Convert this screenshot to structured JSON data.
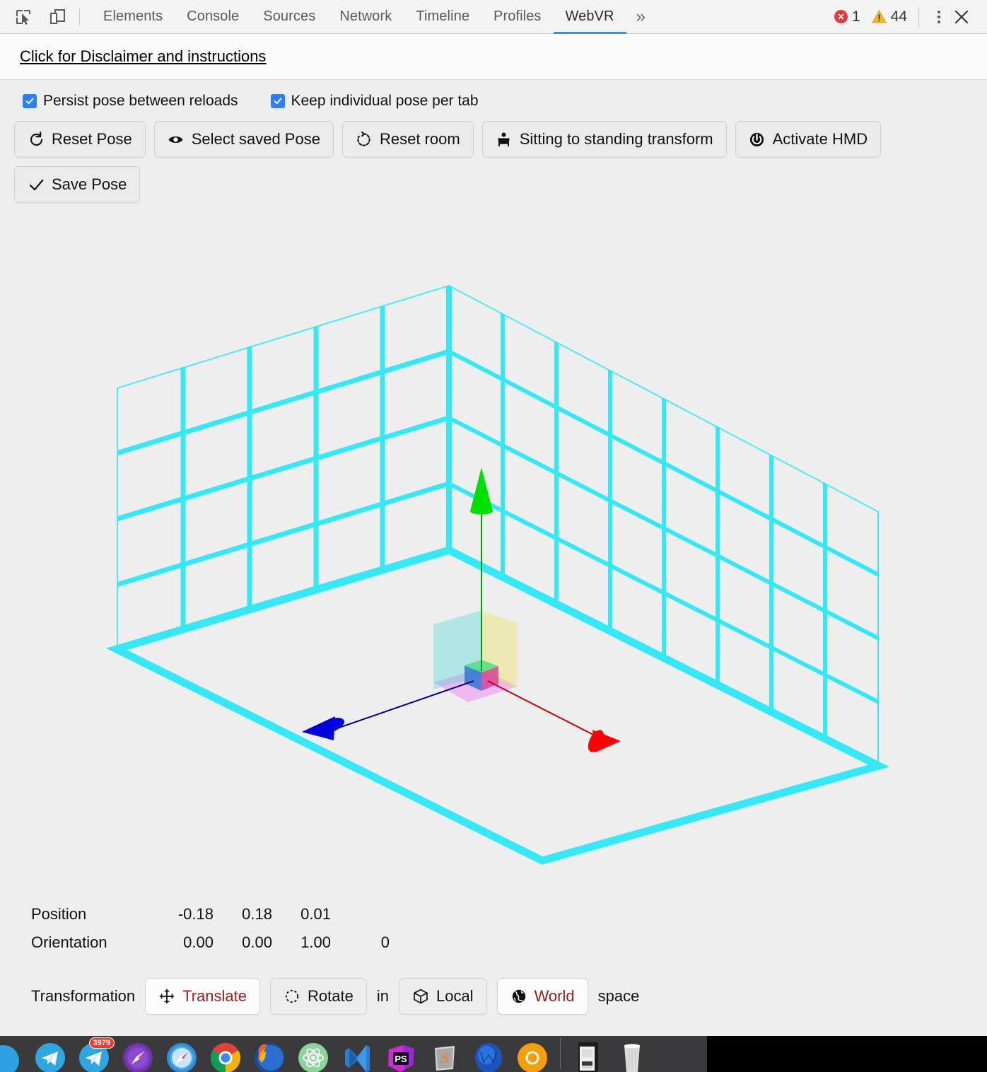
{
  "devtools": {
    "icons": [
      {
        "name": "inspect-element-icon"
      },
      {
        "name": "device-toolbar-icon"
      }
    ],
    "tabs": [
      {
        "label": "Elements",
        "active": false
      },
      {
        "label": "Console",
        "active": false
      },
      {
        "label": "Sources",
        "active": false
      },
      {
        "label": "Network",
        "active": false
      },
      {
        "label": "Timeline",
        "active": false
      },
      {
        "label": "Profiles",
        "active": false
      },
      {
        "label": "WebVR",
        "active": true
      }
    ],
    "more_tabs_glyph": "»",
    "error_count": "1",
    "warning_count": "44",
    "error_badge_glyph": "×",
    "menu_icon": "kebab-menu-icon",
    "close_icon": "close-icon",
    "accent_color": "#4285f4",
    "error_color": "#e53935",
    "warning_color": "#f2b632"
  },
  "disclaimer": {
    "link_text": "Click for Disclaimer and instructions"
  },
  "controls": {
    "checkboxes": [
      {
        "label": "Persist pose between reloads",
        "checked": true
      },
      {
        "label": "Keep individual pose per tab",
        "checked": true
      }
    ],
    "checkbox_color": "#2b7fff",
    "buttons": [
      {
        "label": "Reset Pose",
        "icon": "refresh-icon"
      },
      {
        "label": "Select saved Pose",
        "icon": "eye-icon"
      },
      {
        "label": "Reset room",
        "icon": "rotate-dashed-icon"
      },
      {
        "label": "Sitting to standing transform",
        "icon": "chair-icon"
      },
      {
        "label": "Activate HMD",
        "icon": "power-icon"
      },
      {
        "label": "Save Pose",
        "icon": "check-icon"
      }
    ]
  },
  "scene": {
    "room_color": "#35e8f5",
    "room_edge_color": "#4fe9f7",
    "axes": {
      "x_color": "#e00000",
      "y_color": "#00c000",
      "z_color": "#0000c8"
    },
    "gizmo_planes": {
      "xy_yellow": "#efeca0",
      "zy_cyan": "#aeeeee",
      "xz_magenta": "#f0a6ee"
    },
    "background": "#eeeeee"
  },
  "pose": {
    "position_label": "Position",
    "position": [
      "-0.18",
      "0.18",
      "0.01"
    ],
    "orientation_label": "Orientation",
    "orientation": [
      "0.00",
      "0.00",
      "1.00",
      "0"
    ]
  },
  "transformation": {
    "label": "Transformation",
    "mode_buttons": [
      {
        "label": "Translate",
        "icon": "move-cross-icon",
        "selected": true
      },
      {
        "label": "Rotate",
        "icon": "rotate-dashed-icon",
        "selected": false
      }
    ],
    "in_text": "in",
    "space_buttons": [
      {
        "label": "Local",
        "icon": "cube-icon",
        "selected": false
      },
      {
        "label": "World",
        "icon": "globe-icon",
        "selected": true
      }
    ],
    "space_text": "space",
    "selected_color": "#9b1d1d"
  },
  "dock": {
    "items": [
      {
        "name": "finder-icon",
        "badge": null
      },
      {
        "name": "telegram-icon",
        "badge": null
      },
      {
        "name": "telegram-alt-icon",
        "badge": "3979"
      },
      {
        "name": "safari-technology-preview-icon",
        "badge": null
      },
      {
        "name": "safari-icon",
        "badge": null
      },
      {
        "name": "chrome-icon",
        "badge": null
      },
      {
        "name": "firefox-icon",
        "badge": null
      },
      {
        "name": "atom-icon",
        "badge": null
      },
      {
        "name": "visual-studio-icon",
        "badge": null
      },
      {
        "name": "photoshop-icon",
        "badge": null
      },
      {
        "name": "sublime-text-icon",
        "badge": null
      },
      {
        "name": "webstorm-icon",
        "badge": null
      },
      {
        "name": "chrome-canary-icon",
        "badge": null
      },
      {
        "name": "printer-icon",
        "badge": null
      },
      {
        "name": "trash-icon",
        "badge": null
      }
    ]
  }
}
